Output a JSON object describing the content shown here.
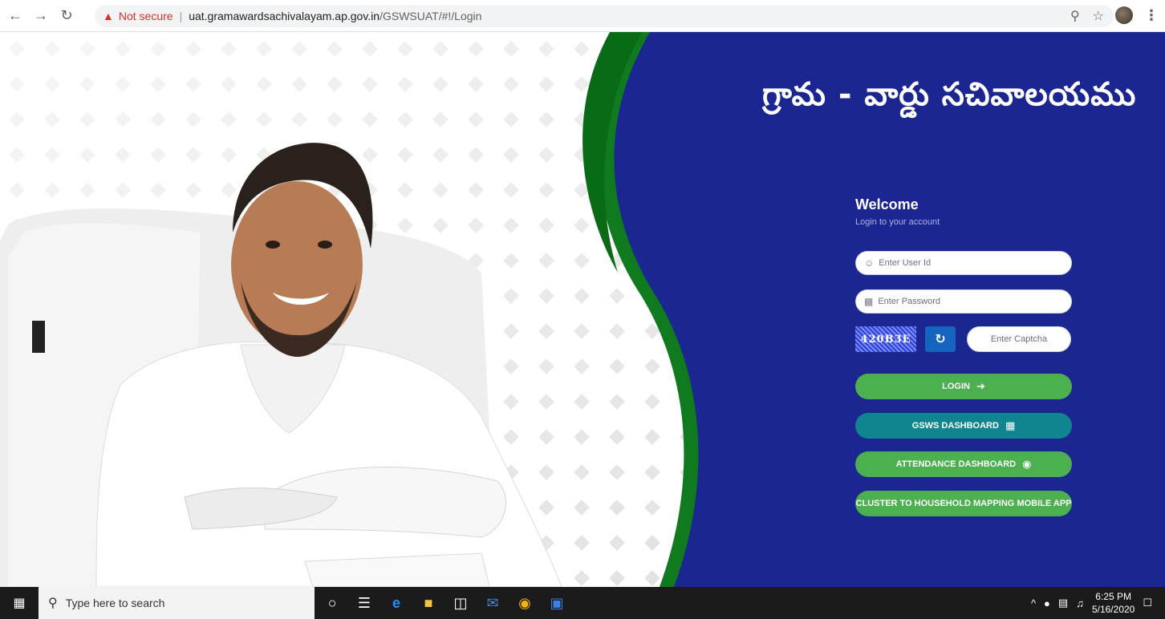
{
  "browser": {
    "security_label": "Not secure",
    "url_host": "uat.gramawardsachivalayam.ap.gov.in",
    "url_path": "/GSWSUAT/#!/Login"
  },
  "app": {
    "title": "గ్రామ - వార్డు సచివాలయము",
    "welcome": "Welcome",
    "subtitle": "Login to your account",
    "captcha_text": "420B3E",
    "userid_placeholder": "Enter User Id",
    "password_placeholder": "Enter Password",
    "captcha_placeholder": "Enter Captcha",
    "buttons": {
      "login": "LOGIN",
      "gsws_dashboard": "GSWS DASHBOARD",
      "attendance_dashboard": "ATTENDANCE DASHBOARD",
      "cluster_app": "CLUSTER TO HOUSEHOLD MAPPING MOBILE APP"
    }
  },
  "taskbar": {
    "search_placeholder": "Type here to search",
    "time": "6:25 PM",
    "date": "5/16/2020"
  },
  "colors": {
    "panel_blue": "#1b2690",
    "accent_green": "#4caf50",
    "accent_teal": "#10858f",
    "wave_green": "#1e8a2a"
  },
  "icons": [
    "back-arrow-icon",
    "forward-arrow-icon",
    "reload-icon",
    "warning-icon",
    "zoom-icon",
    "star-icon",
    "user-icon",
    "lock-icon",
    "refresh-icon",
    "sign-in-icon",
    "dashboard-icon",
    "fingerprint-icon",
    "windows-start-icon",
    "search-icon"
  ]
}
